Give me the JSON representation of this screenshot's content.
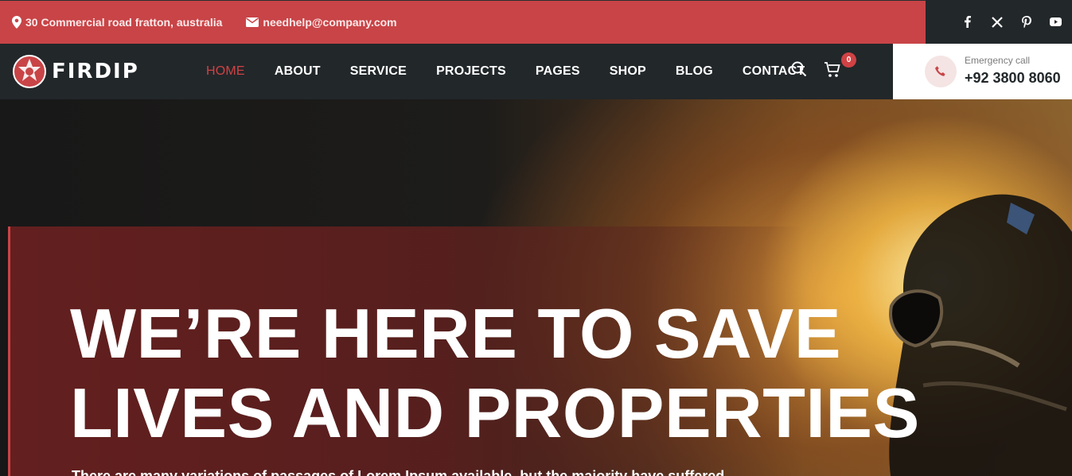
{
  "topbar": {
    "address": "30 Commercial road fratton, australia",
    "email": "needhelp@company.com",
    "social": [
      "facebook-icon",
      "x-icon",
      "pinterest-icon",
      "youtube-icon"
    ]
  },
  "brand": {
    "name": "FIRDIP"
  },
  "nav": {
    "items": [
      {
        "label": "HOME",
        "active": true
      },
      {
        "label": "ABOUT"
      },
      {
        "label": "SERVICE"
      },
      {
        "label": "PROJECTS"
      },
      {
        "label": "PAGES"
      },
      {
        "label": "SHOP"
      },
      {
        "label": "BLOG"
      },
      {
        "label": "CONTACT"
      }
    ],
    "cart_count": "0"
  },
  "emergency": {
    "label": "Emergency call",
    "number": "+92 3800 8060"
  },
  "hero": {
    "title_line1": "WE’RE HERE TO SAVE",
    "title_line2": "LIVES AND PROPERTIES",
    "subtitle": "There are many variations of passages of Lorem Ipsum available, but the majority have suffered"
  },
  "colors": {
    "accent": "#c84447",
    "dark": "#22272a"
  }
}
